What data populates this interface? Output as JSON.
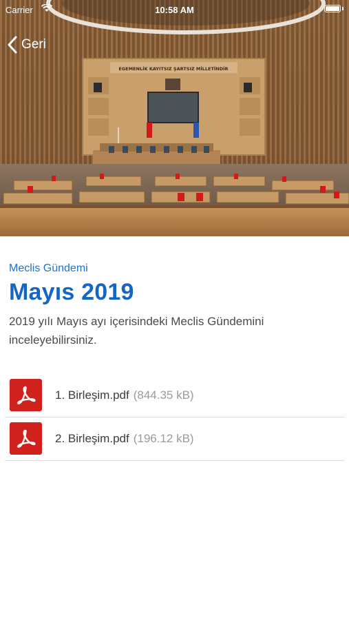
{
  "status_bar": {
    "carrier": "Carrier",
    "time": "10:58 AM",
    "wifi_icon": "wifi-icon",
    "battery_icon": "battery-icon"
  },
  "nav": {
    "back_label": "Geri",
    "back_icon": "chevron-left-icon"
  },
  "hero": {
    "description": "Parliament assembly hall photo",
    "wall_inscription": "EGEMENLİK KAYITSIZ ŞARTSIZ MİLLETİNDİR"
  },
  "content": {
    "category": "Meclis Gündemi",
    "title": "Mayıs 2019",
    "description": "2019 yılı Mayıs ayı içerisindeki Meclis Gündemini inceleyebilirsiniz."
  },
  "files": [
    {
      "name": "1. Birleşim.pdf",
      "size": "(844.35 kB)",
      "icon": "pdf-icon"
    },
    {
      "name": "2. Birleşim.pdf",
      "size": "(196.12 kB)",
      "icon": "pdf-icon"
    }
  ],
  "colors": {
    "accent": "#1466c2",
    "category": "#1a73d0",
    "pdf_red": "#d1211d",
    "divider": "#dedede"
  }
}
